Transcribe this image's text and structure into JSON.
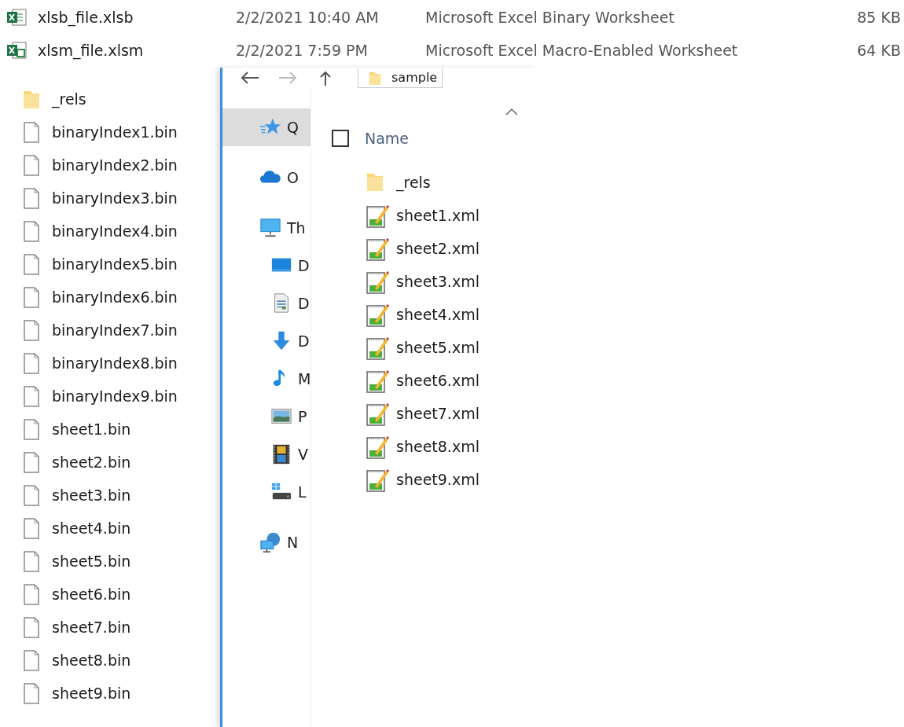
{
  "top_files": [
    {
      "name": "xlsb_file.xlsb",
      "modified": "2/2/2021 10:40 AM",
      "type": "Microsoft Excel Binary Worksheet",
      "size": "85 KB",
      "kind": "xlsb"
    },
    {
      "name": "xlsm_file.xlsm",
      "modified": "2/2/2021 7:59 PM",
      "type": "Microsoft Excel Macro-Enabled Worksheet",
      "size": "64 KB",
      "kind": "xlsm"
    }
  ],
  "left_pane": {
    "items": [
      {
        "name": "_rels",
        "kind": "folder"
      },
      {
        "name": "binaryIndex1.bin",
        "kind": "file"
      },
      {
        "name": "binaryIndex2.bin",
        "kind": "file"
      },
      {
        "name": "binaryIndex3.bin",
        "kind": "file"
      },
      {
        "name": "binaryIndex4.bin",
        "kind": "file"
      },
      {
        "name": "binaryIndex5.bin",
        "kind": "file"
      },
      {
        "name": "binaryIndex6.bin",
        "kind": "file"
      },
      {
        "name": "binaryIndex7.bin",
        "kind": "file"
      },
      {
        "name": "binaryIndex8.bin",
        "kind": "file"
      },
      {
        "name": "binaryIndex9.bin",
        "kind": "file"
      },
      {
        "name": "sheet1.bin",
        "kind": "file"
      },
      {
        "name": "sheet2.bin",
        "kind": "file"
      },
      {
        "name": "sheet3.bin",
        "kind": "file"
      },
      {
        "name": "sheet4.bin",
        "kind": "file"
      },
      {
        "name": "sheet5.bin",
        "kind": "file"
      },
      {
        "name": "sheet6.bin",
        "kind": "file"
      },
      {
        "name": "sheet7.bin",
        "kind": "file"
      },
      {
        "name": "sheet8.bin",
        "kind": "file"
      },
      {
        "name": "sheet9.bin",
        "kind": "file"
      }
    ]
  },
  "explorer": {
    "address": "sample",
    "nav_pane": [
      {
        "label": "Q",
        "kind": "star",
        "selected": true
      },
      {
        "label": "O",
        "kind": "cloud",
        "selected": false
      },
      {
        "label": "Th",
        "kind": "monitor",
        "selected": false
      },
      {
        "label": "D",
        "kind": "desktop",
        "selected": false
      },
      {
        "label": "D",
        "kind": "document",
        "selected": false
      },
      {
        "label": "D",
        "kind": "download",
        "selected": false
      },
      {
        "label": "M",
        "kind": "music",
        "selected": false
      },
      {
        "label": "P",
        "kind": "pictures",
        "selected": false
      },
      {
        "label": "V",
        "kind": "videos",
        "selected": false
      },
      {
        "label": "L",
        "kind": "drive",
        "selected": false
      },
      {
        "label": "N",
        "kind": "network",
        "selected": false
      }
    ],
    "file_list": {
      "column": "Name",
      "select_all_checked": false,
      "items": [
        {
          "name": "_rels",
          "kind": "folder"
        },
        {
          "name": "sheet1.xml",
          "kind": "xml"
        },
        {
          "name": "sheet2.xml",
          "kind": "xml"
        },
        {
          "name": "sheet3.xml",
          "kind": "xml"
        },
        {
          "name": "sheet4.xml",
          "kind": "xml"
        },
        {
          "name": "sheet5.xml",
          "kind": "xml"
        },
        {
          "name": "sheet6.xml",
          "kind": "xml"
        },
        {
          "name": "sheet7.xml",
          "kind": "xml"
        },
        {
          "name": "sheet8.xml",
          "kind": "xml"
        },
        {
          "name": "sheet9.xml",
          "kind": "xml"
        }
      ]
    }
  }
}
